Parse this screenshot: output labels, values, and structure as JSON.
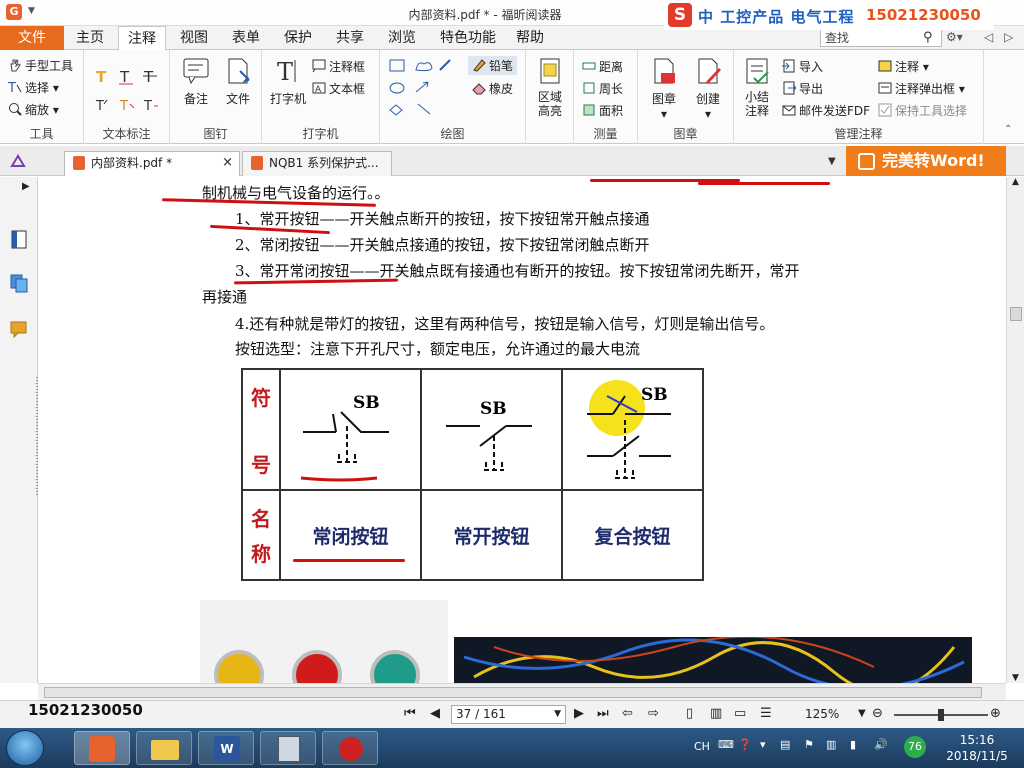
{
  "window": {
    "title": "内部资料.pdf * - 福昕阅读器"
  },
  "brand": {
    "logo": "S",
    "tagline": "中 工控产品 电气工程",
    "phone": "15021230050"
  },
  "tabs": [
    "文件",
    "主页",
    "注释",
    "视图",
    "表单",
    "保护",
    "共享",
    "浏览",
    "特色功能",
    "帮助"
  ],
  "active_tab": "注释",
  "search": {
    "placeholder": "查找"
  },
  "ribbon": {
    "tools": {
      "label": "工具",
      "hand": "手型工具",
      "select": "选择",
      "zoom": "缩放"
    },
    "text_markup": {
      "label": "文本标注"
    },
    "pin": {
      "label": "图钉",
      "note": "备注",
      "file": "文件"
    },
    "typewriter": {
      "label": "打字机",
      "typewriter": "打字机",
      "callout": "注释框",
      "textbox": "文本框"
    },
    "drawing": {
      "label": "绘图",
      "pencil": "铅笔",
      "eraser": "橡皮"
    },
    "area": {
      "label": "区域高亮"
    },
    "measure": {
      "label": "测量",
      "distance": "距离",
      "perimeter": "周长",
      "area": "面积"
    },
    "stamp": {
      "label": "图章",
      "stamp": "图章",
      "create": "创建"
    },
    "manage": {
      "label": "管理注释",
      "summary": "小结注释",
      "import": "导入",
      "export": "导出",
      "email": "邮件发送FDF",
      "annot": "注释",
      "popup": "注释弹出框",
      "keep": "保持工具选择"
    }
  },
  "doc_tabs": [
    {
      "label": "内部资料.pdf *",
      "close": "×"
    },
    {
      "label": "NQB1 系列保护式..."
    }
  ],
  "word_button": "完美转Word!",
  "document": {
    "line0": "制机械与电气设备的运行。。",
    "line1": "1、常开按钮——开关触点断开的按钮，按下按钮常开触点接通",
    "line2": "2、常闭按钮——开关触点接通的按钮，按下按钮常闭触点断开",
    "line3a": "3、常开常闭按钮——开关触点既有接通也有断开的按钮。按下按钮常闭先断开，常开",
    "line3b": "再接通",
    "line4": "4.还有种就是带灯的按钮，这里有两种信号，按钮是输入信号，灯则是输出信号。",
    "line5": "按钮选型：注意下开孔尺寸，额定电压，允许通过的最大电流",
    "table": {
      "row1_header": [
        "符",
        "号"
      ],
      "row2_header": [
        "名",
        "称"
      ],
      "symbol_label": "SB",
      "names": [
        "常闭按钮",
        "常开按钮",
        "复合按钮"
      ]
    }
  },
  "status": {
    "phone": "15021230050",
    "page": "37 / 161",
    "zoom": "125%"
  },
  "taskbar": {
    "lang": "CH",
    "badge": "76",
    "time": "15:16",
    "date": "2018/11/5"
  },
  "colors": {
    "accent_orange": "#e66b1f",
    "annotation_red": "#d10f0f",
    "highlight_yellow": "#f5e21b"
  }
}
